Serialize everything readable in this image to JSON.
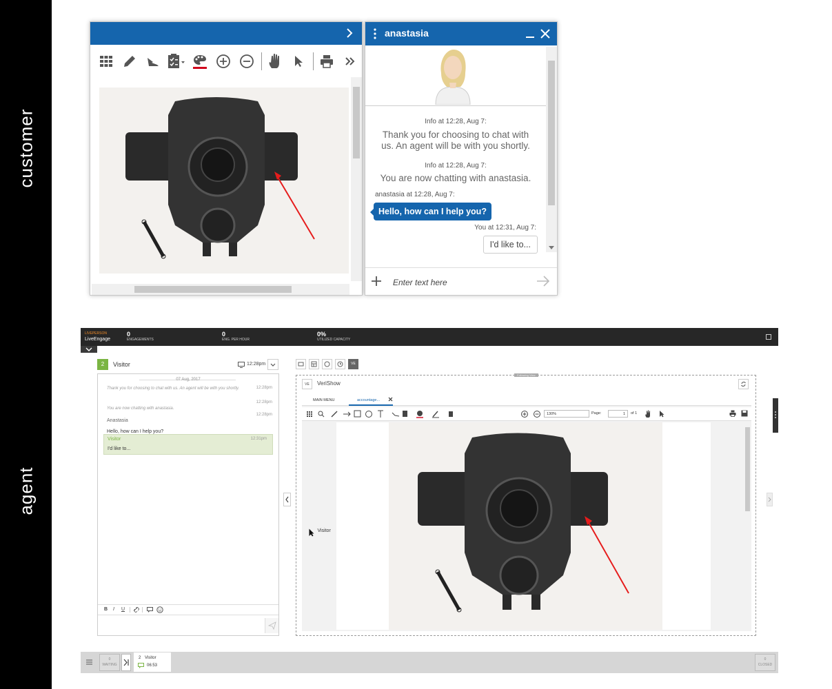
{
  "labels": {
    "customer": "customer",
    "agent": "agent"
  },
  "customer_chat": {
    "agent_name": "anastasia",
    "messages": [
      {
        "type": "info",
        "meta": "Info at 12:28, Aug 7:",
        "text": "Thank you for choosing to chat with us. An agent will be with you shortly."
      },
      {
        "type": "info",
        "meta": "Info at 12:28, Aug 7:",
        "text": "You are now chatting with anastasia."
      },
      {
        "type": "agent",
        "meta": "anastasia at 12:28, Aug 7:",
        "text": "Hello, how can I help you?"
      },
      {
        "type": "visitor",
        "meta": "You at 12:31, Aug 7:",
        "text": "I'd like to..."
      }
    ],
    "input_placeholder": "Enter text here"
  },
  "topbar": {
    "logo_top": "LIVEPERSON",
    "logo_bottom": "LiveEngage",
    "stats": [
      {
        "value": "0",
        "label": "ENGAGEMENTS"
      },
      {
        "value": "0",
        "label": "ENG. PER HOUR"
      },
      {
        "value": "0%",
        "label": "UTILIZED CAPACITY"
      }
    ]
  },
  "agent_chat": {
    "badge": "2",
    "visitor": "Visitor",
    "time": "12:28pm",
    "date": "07 Aug, 2017",
    "lines": [
      {
        "text": "Thank you for choosing to chat with us. An agent will be with you shortly.",
        "time": "12:28pm"
      },
      {
        "text": "You are now chatting with anastasia.",
        "time": "12:28pm"
      }
    ],
    "agent_name": "Anastasia",
    "agent_time": "12:28pm",
    "agent_msg": "Hello, how can I help you?",
    "visitor_name": "Visitor",
    "visitor_time": "12:31pm",
    "visitor_msg": "I'd like to...",
    "format_buttons": [
      "B",
      "I",
      "U"
    ]
  },
  "widget_tabs": {
    "ve": "VE"
  },
  "verishow": {
    "badge": "VE",
    "title": "VeriShow",
    "tab_main": "MAIN MENU",
    "tab_doc": "accountage...",
    "zoom": "130%",
    "page_label": "Page:",
    "page": "1",
    "of": "of 1",
    "visitor_cursor": "Visitor",
    "following": "Following View"
  },
  "bottombar": {
    "waiting_count": "0",
    "waiting_label": "WAITING",
    "conv_count": "2",
    "conv_name": "Visitor",
    "conv_time": "06:53",
    "closed_count": "0",
    "closed_label": "CLOSED"
  }
}
